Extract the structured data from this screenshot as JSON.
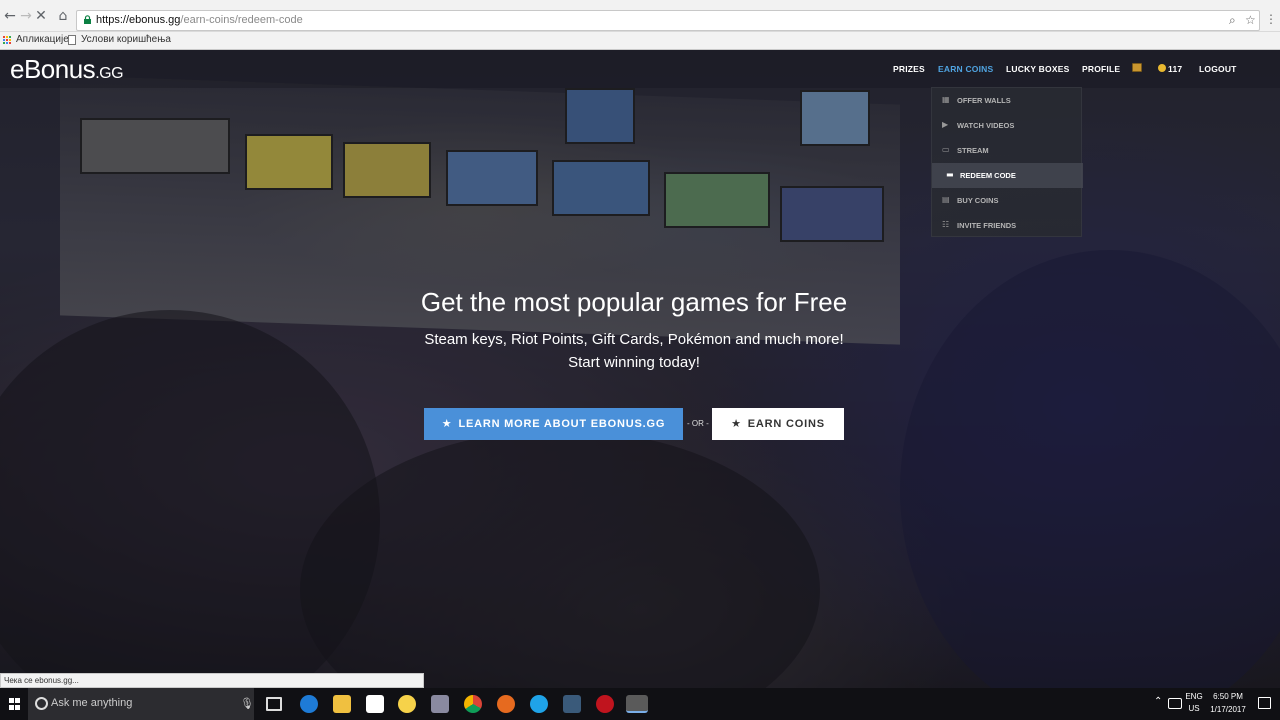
{
  "browser": {
    "url_host": "https://ebonus.gg",
    "url_path": "/earn-coins/redeem-code",
    "bookmarks": [
      {
        "label": "Апликације"
      },
      {
        "label": "Услови коришћења"
      }
    ],
    "status_text": "Чека се ebonus.gg..."
  },
  "site": {
    "logo_main": "eBonus",
    "logo_suffix": ".GG",
    "nav": {
      "prizes": "PRIZES",
      "earn_coins": "EARN COINS",
      "lucky_boxes": "LUCKY BOXES",
      "profile": "PROFILE",
      "coins": "117",
      "logout": "LOGOUT"
    },
    "dropdown": [
      {
        "label": "OFFER WALLS",
        "icon": "grid-icon"
      },
      {
        "label": "WATCH VIDEOS",
        "icon": "play-icon"
      },
      {
        "label": "STREAM",
        "icon": "stream-icon"
      },
      {
        "label": "REDEEM CODE",
        "icon": "ticket-icon",
        "active": true
      },
      {
        "label": "BUY COINS",
        "icon": "coins-icon"
      },
      {
        "label": "INVITE FRIENDS",
        "icon": "friends-icon"
      }
    ]
  },
  "hero": {
    "title": "Get the most popular games for Free",
    "subtitle_line1": "Steam keys, Riot Points, Gift Cards, Pokémon and much more!",
    "subtitle_line2": "Start winning today!",
    "primary_button": "LEARN MORE ABOUT EBONUS.GG",
    "or_text": "- OR -",
    "secondary_button": "EARN COINS"
  },
  "taskbar": {
    "search_placeholder": "Ask me anything",
    "lang_top": "ENG",
    "lang_bottom": "US",
    "time": "6:50 PM",
    "date": "1/17/2017"
  },
  "colors": {
    "accent_blue": "#4a90d9",
    "active_nav": "#4fa3e0",
    "coin": "#e8b830"
  }
}
